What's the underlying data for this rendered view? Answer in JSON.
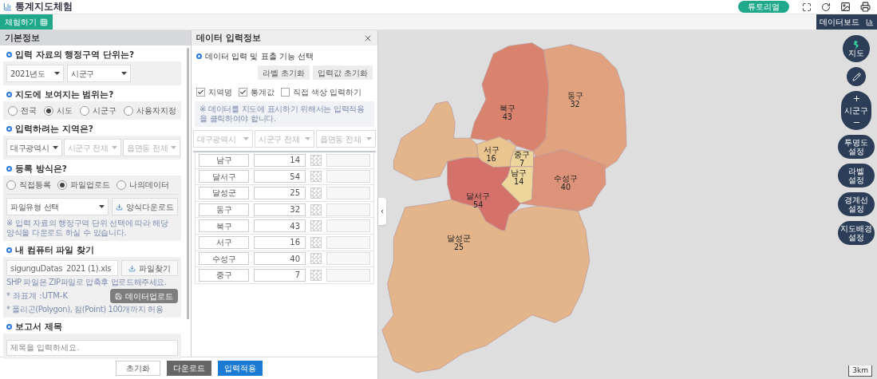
{
  "app": {
    "title": "통계지도체험",
    "tutorial_button": "튜토리얼",
    "toolbar": {
      "experience_button": "체험하기",
      "dashboard_button": "데이터보드"
    }
  },
  "basic_info": {
    "title": "기본정보",
    "admin_unit": {
      "question": "입력 자료의 행정구역 단위는?",
      "selects": [
        {
          "value": "2021년도",
          "disabled": false
        },
        {
          "value": "시군구",
          "disabled": false
        }
      ]
    },
    "scope": {
      "question": "지도에 보여지는 범위는?",
      "options": [
        {
          "label": "전국",
          "selected": false
        },
        {
          "label": "시도",
          "selected": true
        },
        {
          "label": "시군구",
          "selected": false
        },
        {
          "label": "사용자지정",
          "selected": false
        }
      ]
    },
    "region": {
      "question": "입력하려는 지역은?",
      "selects": [
        {
          "value": "대구광역시",
          "disabled": false
        },
        {
          "value": "시군구 전체",
          "disabled": true
        },
        {
          "value": "읍면동 전체",
          "disabled": true
        }
      ]
    },
    "registration": {
      "question": "등록 방식은?",
      "options": [
        {
          "label": "직접등록",
          "selected": false
        },
        {
          "label": "파일업로드",
          "selected": true
        },
        {
          "label": "나의데이터",
          "selected": false
        }
      ],
      "file_type": {
        "value": "파일유형 선택",
        "disabled": false
      },
      "template_button": "양식다운로드",
      "note": "※ 입력 자료의 행정구역 단위 선택에 따라 해당 양식을 다운로드 하실 수 있습니다."
    },
    "file": {
      "question": "내 컴퓨터 파일 찾기",
      "filename": "sigunguDatas_2021 (1).xls",
      "browse_button": "파일찾기",
      "hints": [
        "SHP 파일은 ZIP파일로 압축후 업로드해주세요.",
        "* 좌표계 :UTM-K",
        "* 폴리곤(Polygon), 점(Point) 100개까지 허용"
      ],
      "upload_button": "데이터업로드"
    },
    "report_title": {
      "question": "보고서 제목",
      "placeholder": "제목을 입력하세요."
    }
  },
  "data_panel": {
    "title": "데이터 입력정보",
    "function_label": "데이터 입력 및 표출 기능 선택",
    "buttons": [
      "라벨 초기화",
      "입력값 초기화"
    ],
    "checkboxes": [
      {
        "label": "지역명",
        "checked": true
      },
      {
        "label": "통계값",
        "checked": true
      },
      {
        "label": "직접 색상 입력하기",
        "checked": false
      }
    ],
    "note": "※ 데이터를 지도에 표시하기 위해서는 입력적용을 클릭하여야 합니다.",
    "filters": [
      {
        "value": "대구광역시",
        "disabled": true
      },
      {
        "value": "시군구 전체",
        "disabled": true
      },
      {
        "value": "읍면동 전체",
        "disabled": true
      }
    ],
    "rows": [
      {
        "name": "남구",
        "value": "14"
      },
      {
        "name": "달서구",
        "value": "54"
      },
      {
        "name": "달성군",
        "value": "25"
      },
      {
        "name": "동구",
        "value": "32"
      },
      {
        "name": "북구",
        "value": "43"
      },
      {
        "name": "서구",
        "value": "16"
      },
      {
        "name": "수성구",
        "value": "40"
      },
      {
        "name": "중구",
        "value": "7"
      }
    ]
  },
  "footer_buttons": [
    {
      "label": "초기화",
      "kind": "default"
    },
    {
      "label": "다운로드",
      "kind": "dark"
    },
    {
      "label": "입력적용",
      "kind": "primary"
    }
  ],
  "map": {
    "districts": [
      {
        "name": "북구",
        "value": "43",
        "color": "#d9836f"
      },
      {
        "name": "동구",
        "value": "32",
        "color": "#e0a27f"
      },
      {
        "name": "서구",
        "value": "16",
        "color": "#e9c48f"
      },
      {
        "name": "중구",
        "value": "7",
        "color": "#edd69c"
      },
      {
        "name": "남구",
        "value": "14",
        "color": "#edd69c"
      },
      {
        "name": "수성구",
        "value": "40",
        "color": "#dd9379"
      },
      {
        "name": "달서구",
        "value": "54",
        "color": "#d4716a"
      },
      {
        "name": "달성군",
        "value": "25",
        "color": "#e4b58a"
      }
    ],
    "scale": "3km"
  },
  "map_controls": {
    "map_button": "지도",
    "zoom_label": "시군구",
    "settings": [
      "투명도 설정",
      "라벨 설정",
      "경계선 설정",
      "지도배경 설정"
    ]
  }
}
